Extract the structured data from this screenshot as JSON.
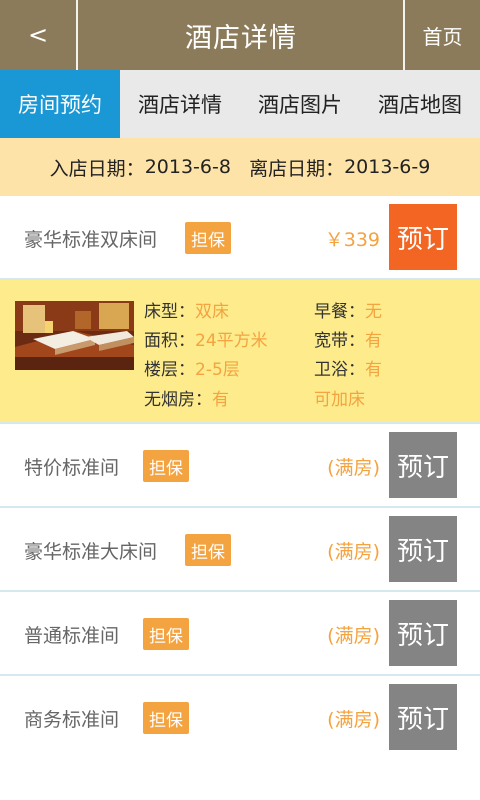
{
  "header": {
    "back_label": "<",
    "title": "酒店详情",
    "home_label": "首页"
  },
  "tabs": [
    {
      "label": "房间预约",
      "active": true
    },
    {
      "label": "酒店详情",
      "active": false
    },
    {
      "label": "酒店图片",
      "active": false
    },
    {
      "label": "酒店地图",
      "active": false
    }
  ],
  "dates": {
    "checkin_label": "入店日期：",
    "checkin_value": "2013-6-8",
    "checkout_label": "离店日期：",
    "checkout_value": "2013-6-9"
  },
  "rooms": [
    {
      "name": "豪华标准双床间",
      "badge": "担保",
      "price": "￥339",
      "book": "预订",
      "status": "available"
    },
    {
      "name": "特价标准间",
      "badge": "担保",
      "price": "(满房)",
      "book": "预订",
      "status": "full"
    },
    {
      "name": "豪华标准大床间",
      "badge": "担保",
      "price": "(满房)",
      "book": "预订",
      "status": "full"
    },
    {
      "name": "普通标准间",
      "badge": "担保",
      "price": "(满房)",
      "book": "预订",
      "status": "full"
    },
    {
      "name": "商务标准间",
      "badge": "担保",
      "price": "(满房)",
      "book": "预订",
      "status": "full"
    }
  ],
  "details": {
    "bed_label": "床型：",
    "bed_value": "双床",
    "area_label": "面积：",
    "area_value": "24平方米",
    "floor_label": "楼层：",
    "floor_value": "2-5层",
    "nosmoke_label": "无烟房：",
    "nosmoke_value": "有",
    "breakfast_label": "早餐：",
    "breakfast_value": "无",
    "broadband_label": "宽带：",
    "broadband_value": "有",
    "bath_label": "卫浴：",
    "bath_value": "有",
    "extra_bed": "可加床"
  },
  "colors": {
    "header": "#8b7b5a",
    "tab_active": "#1a98d6",
    "badge": "#f4a341",
    "book_available": "#f36523",
    "book_full": "#848484",
    "details_bg": "#fdeb8c",
    "date_bg": "#fde3a7"
  }
}
